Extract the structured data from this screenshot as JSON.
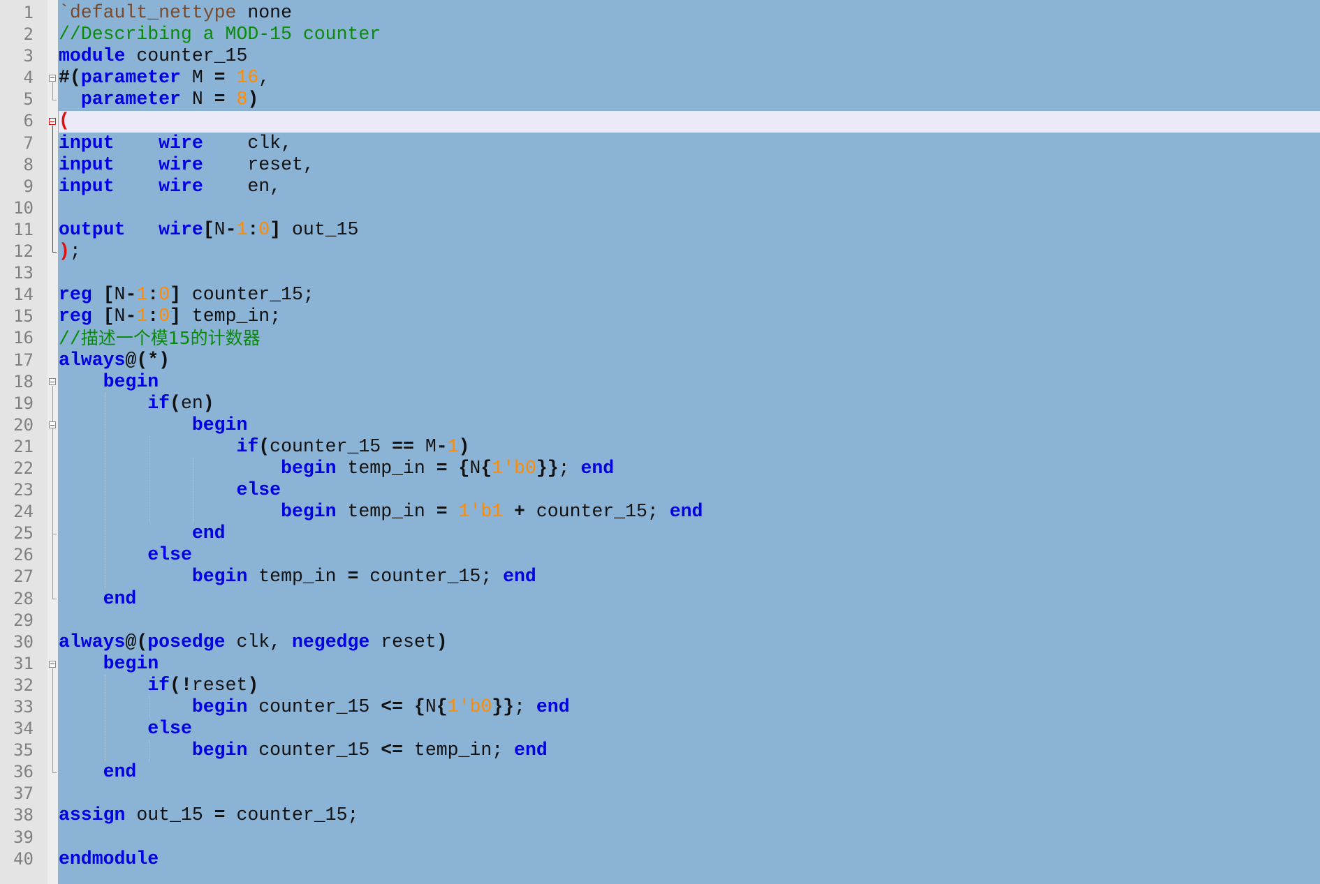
{
  "editor": {
    "language": "verilog",
    "caret_line": 6,
    "colors": {
      "background": "#8ab3d6",
      "gutter": "#e4e4e4",
      "caret_line": "#eae9f8",
      "keyword": "#0000e0",
      "number": "#ff8c00",
      "comment": "#0a8a0a",
      "directive": "#7a4a2a",
      "brace_highlight": "#e01010"
    },
    "fold_markers": [
      {
        "line": 4,
        "icon": "fold-minus-icon"
      },
      {
        "line": 6,
        "icon": "fold-minus-icon",
        "highlight": true
      },
      {
        "line": 18,
        "icon": "fold-minus-icon"
      },
      {
        "line": 20,
        "icon": "fold-minus-icon"
      },
      {
        "line": 31,
        "icon": "fold-minus-icon"
      }
    ],
    "lines": [
      [
        {
          "t": "dir",
          "v": "`default_nettype"
        },
        {
          "t": "id",
          "v": " none"
        }
      ],
      [
        {
          "t": "cmt",
          "v": "//Describing a MOD-15 counter"
        }
      ],
      [
        {
          "t": "kw",
          "v": "module"
        },
        {
          "t": "id",
          "v": " counter_15"
        }
      ],
      [
        {
          "t": "op",
          "v": "#("
        },
        {
          "t": "kw",
          "v": "parameter"
        },
        {
          "t": "id",
          "v": " M "
        },
        {
          "t": "op",
          "v": "="
        },
        {
          "t": "id",
          "v": " "
        },
        {
          "t": "num",
          "v": "16"
        },
        {
          "t": "id",
          "v": ","
        }
      ],
      [
        {
          "t": "id",
          "v": "  "
        },
        {
          "t": "kw",
          "v": "parameter"
        },
        {
          "t": "id",
          "v": " N "
        },
        {
          "t": "op",
          "v": "="
        },
        {
          "t": "id",
          "v": " "
        },
        {
          "t": "num",
          "v": "8"
        },
        {
          "t": "op",
          "v": ")"
        }
      ],
      [
        {
          "t": "err",
          "v": "("
        }
      ],
      [
        {
          "t": "kw",
          "v": "input"
        },
        {
          "t": "id",
          "v": "    "
        },
        {
          "t": "kw",
          "v": "wire"
        },
        {
          "t": "id",
          "v": "    clk,"
        }
      ],
      [
        {
          "t": "kw",
          "v": "input"
        },
        {
          "t": "id",
          "v": "    "
        },
        {
          "t": "kw",
          "v": "wire"
        },
        {
          "t": "id",
          "v": "    reset,"
        }
      ],
      [
        {
          "t": "kw",
          "v": "input"
        },
        {
          "t": "id",
          "v": "    "
        },
        {
          "t": "kw",
          "v": "wire"
        },
        {
          "t": "id",
          "v": "    en,"
        }
      ],
      [],
      [
        {
          "t": "kw",
          "v": "output"
        },
        {
          "t": "id",
          "v": "   "
        },
        {
          "t": "kw",
          "v": "wire"
        },
        {
          "t": "op",
          "v": "["
        },
        {
          "t": "id",
          "v": "N"
        },
        {
          "t": "op",
          "v": "-"
        },
        {
          "t": "num",
          "v": "1"
        },
        {
          "t": "op",
          "v": ":"
        },
        {
          "t": "num",
          "v": "0"
        },
        {
          "t": "op",
          "v": "]"
        },
        {
          "t": "id",
          "v": " out_15"
        }
      ],
      [
        {
          "t": "err",
          "v": ")"
        },
        {
          "t": "id",
          "v": ";"
        }
      ],
      [],
      [
        {
          "t": "kw",
          "v": "reg"
        },
        {
          "t": "id",
          "v": " "
        },
        {
          "t": "op",
          "v": "["
        },
        {
          "t": "id",
          "v": "N"
        },
        {
          "t": "op",
          "v": "-"
        },
        {
          "t": "num",
          "v": "1"
        },
        {
          "t": "op",
          "v": ":"
        },
        {
          "t": "num",
          "v": "0"
        },
        {
          "t": "op",
          "v": "]"
        },
        {
          "t": "id",
          "v": " counter_15;"
        }
      ],
      [
        {
          "t": "kw",
          "v": "reg"
        },
        {
          "t": "id",
          "v": " "
        },
        {
          "t": "op",
          "v": "["
        },
        {
          "t": "id",
          "v": "N"
        },
        {
          "t": "op",
          "v": "-"
        },
        {
          "t": "num",
          "v": "1"
        },
        {
          "t": "op",
          "v": ":"
        },
        {
          "t": "num",
          "v": "0"
        },
        {
          "t": "op",
          "v": "]"
        },
        {
          "t": "id",
          "v": " temp_in;"
        }
      ],
      [
        {
          "t": "cmt",
          "v": "//"
        },
        {
          "t": "cmt-cjk",
          "v": "描述一个模15的计数器"
        }
      ],
      [
        {
          "t": "kw",
          "v": "always"
        },
        {
          "t": "op",
          "v": "@(*)"
        }
      ],
      [
        {
          "t": "id",
          "v": "    "
        },
        {
          "t": "kw",
          "v": "begin"
        }
      ],
      [
        {
          "t": "id",
          "v": "        "
        },
        {
          "t": "kw",
          "v": "if"
        },
        {
          "t": "op",
          "v": "("
        },
        {
          "t": "id",
          "v": "en"
        },
        {
          "t": "op",
          "v": ")"
        }
      ],
      [
        {
          "t": "id",
          "v": "            "
        },
        {
          "t": "kw",
          "v": "begin"
        }
      ],
      [
        {
          "t": "id",
          "v": "                "
        },
        {
          "t": "kw",
          "v": "if"
        },
        {
          "t": "op",
          "v": "("
        },
        {
          "t": "id",
          "v": "counter_15 "
        },
        {
          "t": "op",
          "v": "=="
        },
        {
          "t": "id",
          "v": " M"
        },
        {
          "t": "op",
          "v": "-"
        },
        {
          "t": "num",
          "v": "1"
        },
        {
          "t": "op",
          "v": ")"
        }
      ],
      [
        {
          "t": "id",
          "v": "                    "
        },
        {
          "t": "kw",
          "v": "begin"
        },
        {
          "t": "id",
          "v": " temp_in "
        },
        {
          "t": "op",
          "v": "="
        },
        {
          "t": "id",
          "v": " "
        },
        {
          "t": "op",
          "v": "{"
        },
        {
          "t": "id",
          "v": "N"
        },
        {
          "t": "op",
          "v": "{"
        },
        {
          "t": "num",
          "v": "1'b0"
        },
        {
          "t": "op",
          "v": "}}"
        },
        {
          "t": "id",
          "v": "; "
        },
        {
          "t": "kw",
          "v": "end"
        }
      ],
      [
        {
          "t": "id",
          "v": "                "
        },
        {
          "t": "kw",
          "v": "else"
        }
      ],
      [
        {
          "t": "id",
          "v": "                    "
        },
        {
          "t": "kw",
          "v": "begin"
        },
        {
          "t": "id",
          "v": " temp_in "
        },
        {
          "t": "op",
          "v": "="
        },
        {
          "t": "id",
          "v": " "
        },
        {
          "t": "num",
          "v": "1'b1"
        },
        {
          "t": "id",
          "v": " "
        },
        {
          "t": "op",
          "v": "+"
        },
        {
          "t": "id",
          "v": " counter_15; "
        },
        {
          "t": "kw",
          "v": "end"
        }
      ],
      [
        {
          "t": "id",
          "v": "            "
        },
        {
          "t": "kw",
          "v": "end"
        }
      ],
      [
        {
          "t": "id",
          "v": "        "
        },
        {
          "t": "kw",
          "v": "else"
        }
      ],
      [
        {
          "t": "id",
          "v": "            "
        },
        {
          "t": "kw",
          "v": "begin"
        },
        {
          "t": "id",
          "v": " temp_in "
        },
        {
          "t": "op",
          "v": "="
        },
        {
          "t": "id",
          "v": " counter_15; "
        },
        {
          "t": "kw",
          "v": "end"
        }
      ],
      [
        {
          "t": "id",
          "v": "    "
        },
        {
          "t": "kw",
          "v": "end"
        }
      ],
      [],
      [
        {
          "t": "kw",
          "v": "always"
        },
        {
          "t": "op",
          "v": "@("
        },
        {
          "t": "kw",
          "v": "posedge"
        },
        {
          "t": "id",
          "v": " clk, "
        },
        {
          "t": "kw",
          "v": "negedge"
        },
        {
          "t": "id",
          "v": " reset"
        },
        {
          "t": "op",
          "v": ")"
        }
      ],
      [
        {
          "t": "id",
          "v": "    "
        },
        {
          "t": "kw",
          "v": "begin"
        }
      ],
      [
        {
          "t": "id",
          "v": "        "
        },
        {
          "t": "kw",
          "v": "if"
        },
        {
          "t": "op",
          "v": "(!"
        },
        {
          "t": "id",
          "v": "reset"
        },
        {
          "t": "op",
          "v": ")"
        }
      ],
      [
        {
          "t": "id",
          "v": "            "
        },
        {
          "t": "kw",
          "v": "begin"
        },
        {
          "t": "id",
          "v": " counter_15 "
        },
        {
          "t": "op",
          "v": "<="
        },
        {
          "t": "id",
          "v": " "
        },
        {
          "t": "op",
          "v": "{"
        },
        {
          "t": "id",
          "v": "N"
        },
        {
          "t": "op",
          "v": "{"
        },
        {
          "t": "num",
          "v": "1'b0"
        },
        {
          "t": "op",
          "v": "}}"
        },
        {
          "t": "id",
          "v": "; "
        },
        {
          "t": "kw",
          "v": "end"
        }
      ],
      [
        {
          "t": "id",
          "v": "        "
        },
        {
          "t": "kw",
          "v": "else"
        }
      ],
      [
        {
          "t": "id",
          "v": "            "
        },
        {
          "t": "kw",
          "v": "begin"
        },
        {
          "t": "id",
          "v": " counter_15 "
        },
        {
          "t": "op",
          "v": "<="
        },
        {
          "t": "id",
          "v": " temp_in; "
        },
        {
          "t": "kw",
          "v": "end"
        }
      ],
      [
        {
          "t": "id",
          "v": "    "
        },
        {
          "t": "kw",
          "v": "end"
        }
      ],
      [],
      [
        {
          "t": "kw",
          "v": "assign"
        },
        {
          "t": "id",
          "v": " out_15 "
        },
        {
          "t": "op",
          "v": "="
        },
        {
          "t": "id",
          "v": " counter_15;"
        }
      ],
      [],
      [
        {
          "t": "kw",
          "v": "endmodule"
        }
      ]
    ]
  }
}
